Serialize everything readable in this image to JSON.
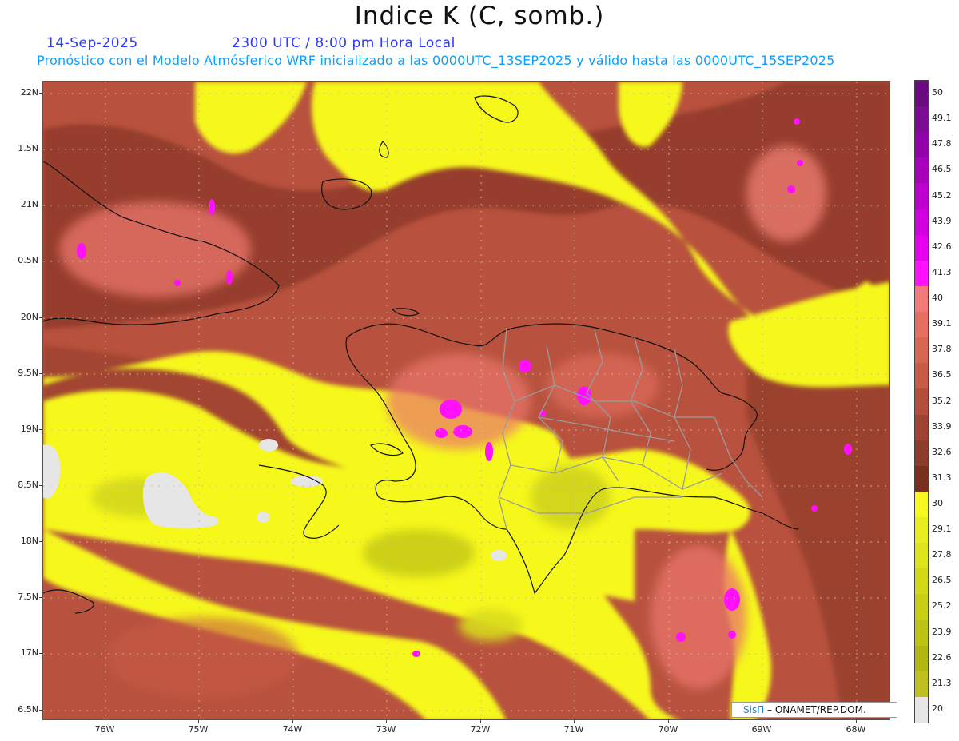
{
  "header": {
    "title": "Indice K (C, somb.)",
    "date": "14-Sep-2025",
    "time": "2300 UTC / 8:00 pm Hora Local",
    "description": "Pronóstico con el Modelo Atmósferico WRF inicializado a las 0000UTC_13SEP2025 y válido hasta las  0000UTC_15SEP2025"
  },
  "axes": {
    "lat_labels": [
      "22N",
      "1.5N",
      "21N",
      "0.5N",
      "20N",
      "9.5N",
      "19N",
      "8.5N",
      "18N",
      "7.5N",
      "17N",
      "6.5N"
    ],
    "lon_labels": [
      "76W",
      "75W",
      "74W",
      "73W",
      "72W",
      "71W",
      "70W",
      "69W",
      "68W"
    ]
  },
  "colorbar": {
    "labels": [
      "50",
      "49.1",
      "47.8",
      "46.5",
      "45.2",
      "43.9",
      "42.6",
      "41.3",
      "40",
      "39.1",
      "37.8",
      "36.5",
      "35.2",
      "33.9",
      "32.6",
      "31.3",
      "30",
      "29.1",
      "27.8",
      "26.5",
      "25.2",
      "23.9",
      "22.6",
      "21.3",
      "20"
    ],
    "colors": [
      "#6a0a80",
      "#7d0a96",
      "#9400aa",
      "#a800bd",
      "#bd00d0",
      "#d000e0",
      "#e400ee",
      "#ff10ff",
      "#f47a7a",
      "#e86d62",
      "#d8654f",
      "#c85a46",
      "#b54c3c",
      "#a14134",
      "#8e3a2c",
      "#7a2e1e",
      "#f6f81e",
      "#e8ee1e",
      "#dde41c",
      "#d2d818",
      "#c8d016",
      "#bcc414",
      "#b2b812",
      "#c0c020",
      "#e6e6e6"
    ]
  },
  "credit": {
    "brand": "SisΠ",
    "text": " – ONAMET/REP.DOM."
  }
}
